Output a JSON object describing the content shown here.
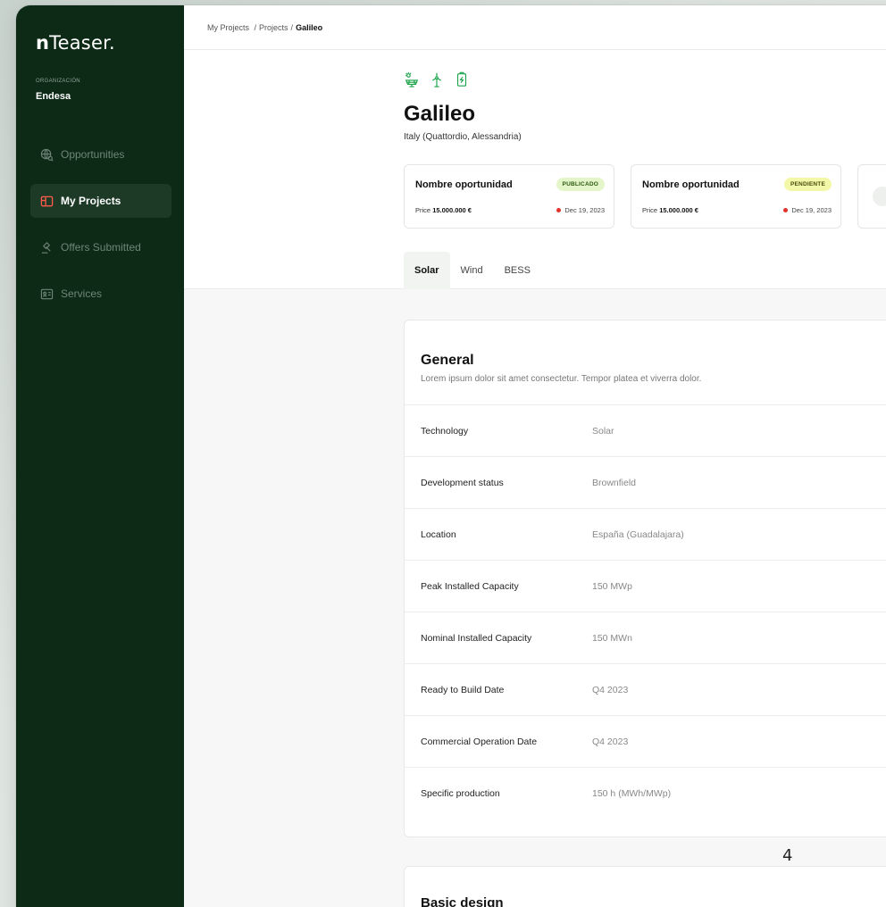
{
  "sidebar": {
    "logo_bold": "n",
    "logo_rest": "Teaser.",
    "org_label": "ORGANIZACIÓN",
    "org_name": "Endesa",
    "items": [
      {
        "label": "Opportunities",
        "icon": "globe-icon",
        "active": false
      },
      {
        "label": "My Projects",
        "icon": "folder-icon",
        "active": true
      },
      {
        "label": "Offers Submitted",
        "icon": "auction-icon",
        "active": false
      },
      {
        "label": "Services",
        "icon": "id-card-icon",
        "active": false
      }
    ]
  },
  "breadcrumb": {
    "item1": "My Projects",
    "item2": "Projects",
    "current": "Galileo"
  },
  "project": {
    "icons": [
      "solar-panel-icon",
      "wind-turbine-icon",
      "battery-icon"
    ],
    "title": "Galileo",
    "subtitle": "Italy (Quattordio, Alessandria)"
  },
  "cards": [
    {
      "title": "Nombre oportunidad",
      "badge": "PUBLICADO",
      "price_label": "Price",
      "price": "15.000.000 €",
      "date": "Dec 19, 2023"
    },
    {
      "title": "Nombre oportunidad",
      "badge": "PENDIENTE",
      "price_label": "Price",
      "price": "15.000.000 €",
      "date": "Dec 19, 2023"
    }
  ],
  "tabs": [
    "Solar",
    "Wind",
    "BESS"
  ],
  "general": {
    "title": "General",
    "description": "Lorem ipsum dolor sit amet consectetur. Tempor platea et viverra dolor.",
    "rows": [
      {
        "label": "Technology",
        "value": "Solar"
      },
      {
        "label": "Development status",
        "value": "Brownfield"
      },
      {
        "label": "Location",
        "value": "España (Guadalajara)"
      },
      {
        "label": "Peak Installed Capacity",
        "value": "150 MWp"
      },
      {
        "label": "Nominal Installed Capacity",
        "value": "150 MWn"
      },
      {
        "label": "Ready to Build Date",
        "value": "Q4 2023"
      },
      {
        "label": "Commercial Operation Date",
        "value": "Q4 2023"
      },
      {
        "label": "Specific production",
        "value": "150 h (MWh/MWp)"
      }
    ]
  },
  "page_number": "4",
  "basic_design": {
    "title": "Basic design"
  },
  "colors": {
    "sidebar_bg": "#0d2a17",
    "accent_icon": "#1aa34a",
    "active_icon": "#ff5b4a",
    "badge_published_bg": "#e3f5c9",
    "badge_pending_bg": "#f3f7a8",
    "date_dot": "#e3322a"
  }
}
